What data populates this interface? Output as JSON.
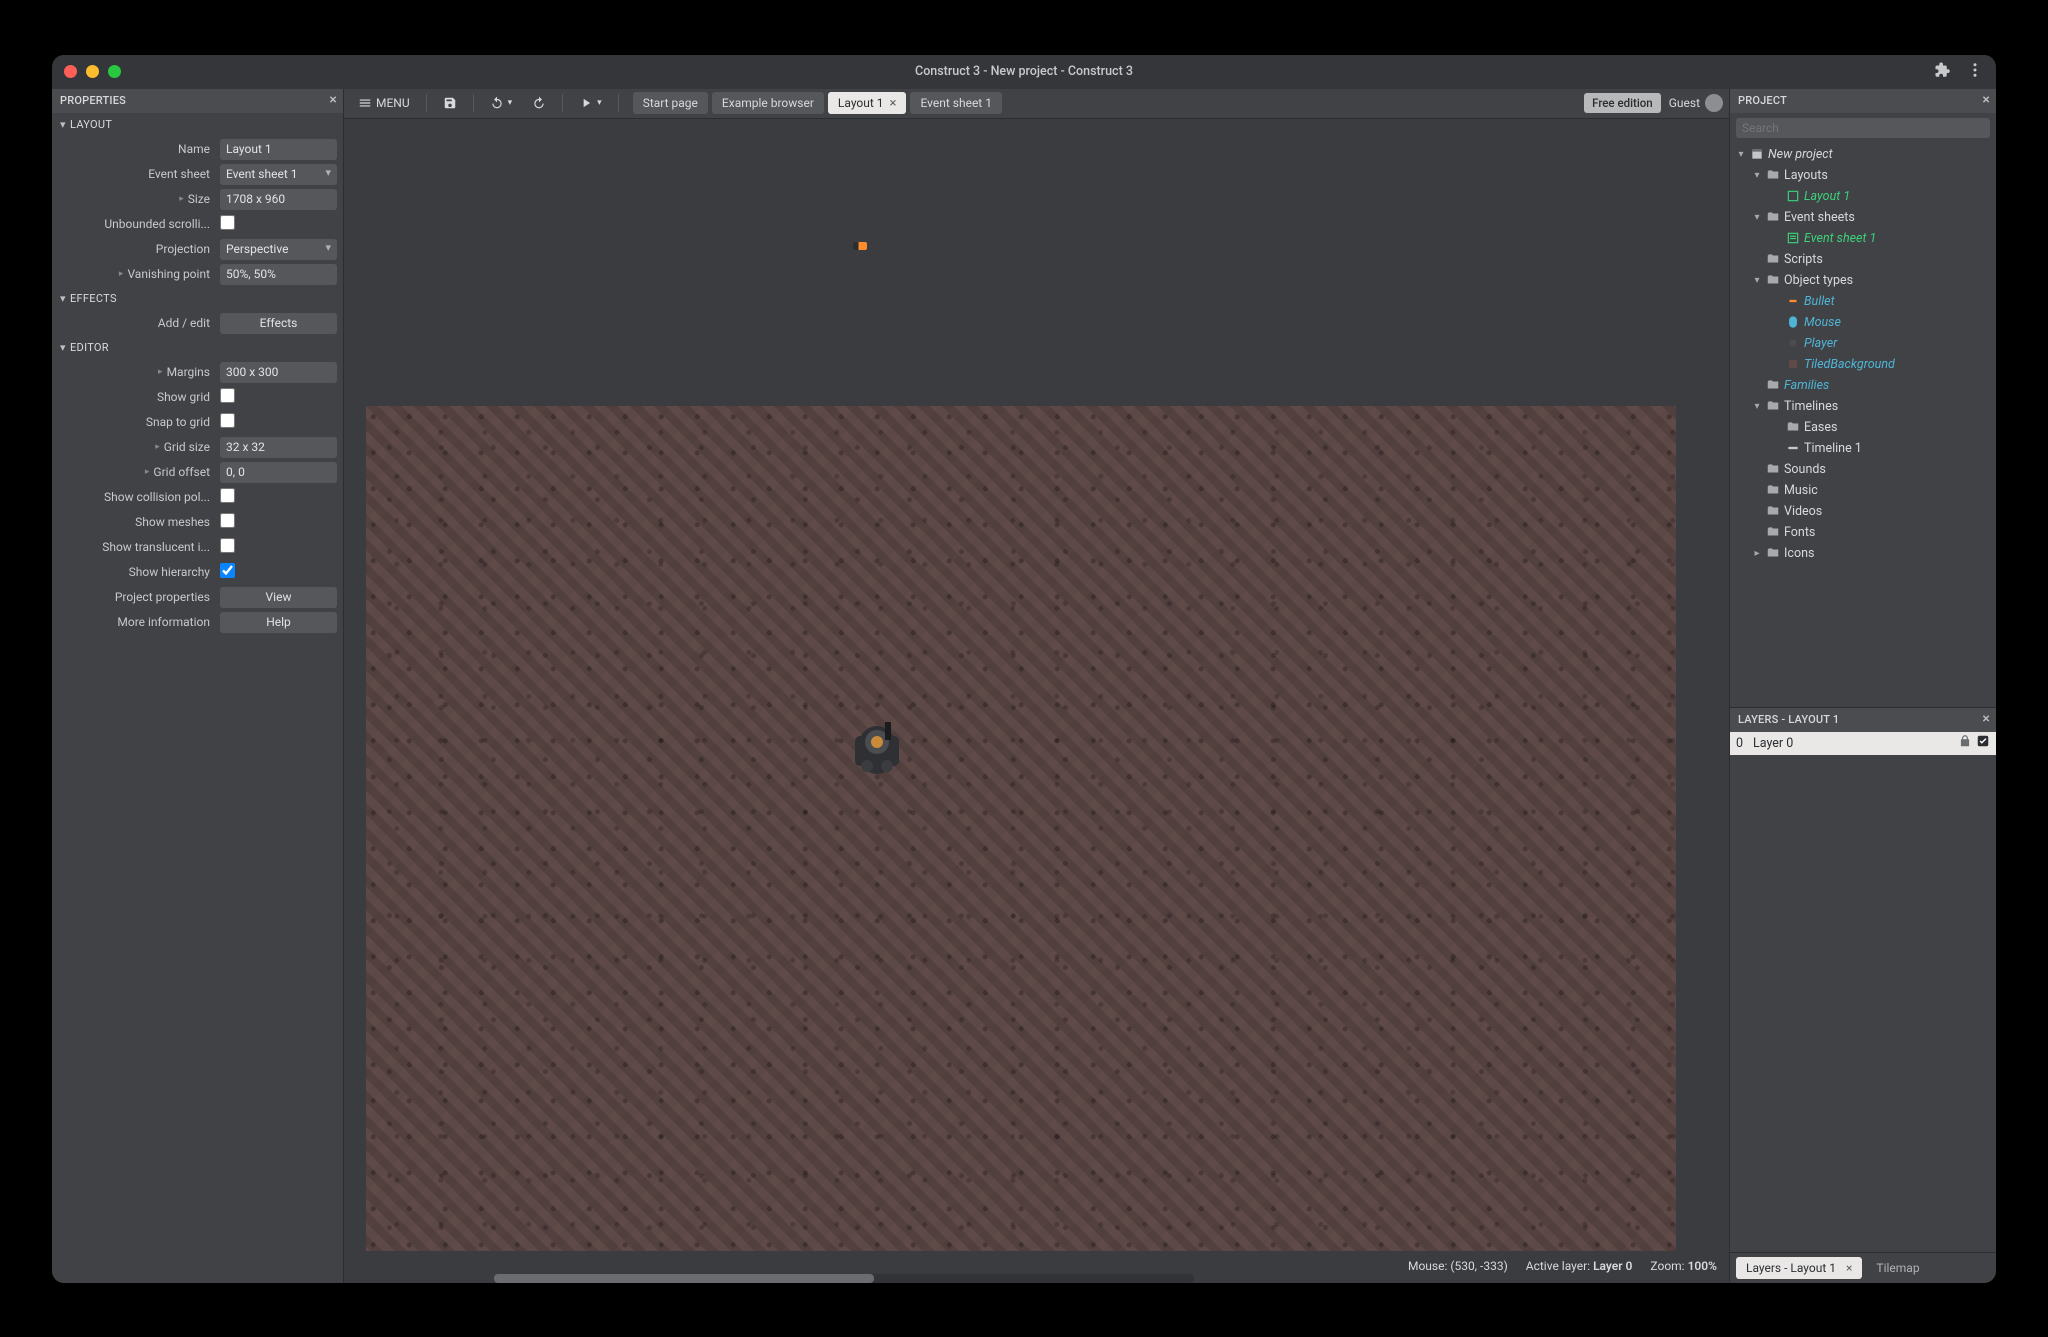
{
  "titlebar": {
    "title": "Construct 3 - New project - Construct 3"
  },
  "panels": {
    "properties_title": "PROPERTIES",
    "project_title": "PROJECT",
    "layers_title": "LAYERS - LAYOUT 1",
    "search_placeholder": "Search"
  },
  "toolbar": {
    "menu": "MENU",
    "free_edition": "Free edition",
    "guest": "Guest",
    "tabs": [
      {
        "label": "Start page"
      },
      {
        "label": "Example browser"
      },
      {
        "label": "Layout 1",
        "active": true,
        "closable": true
      },
      {
        "label": "Event sheet 1"
      }
    ]
  },
  "groups": {
    "layout": "LAYOUT",
    "effects": "EFFECTS",
    "editor": "EDITOR"
  },
  "properties": {
    "layout": {
      "name_label": "Name",
      "name_value": "Layout 1",
      "eventsheet_label": "Event sheet",
      "eventsheet_value": "Event sheet 1",
      "size_label": "Size",
      "size_value": "1708 x 960",
      "unbounded_label": "Unbounded scrolli...",
      "unbounded_value": false,
      "projection_label": "Projection",
      "projection_value": "Perspective",
      "vanishing_label": "Vanishing point",
      "vanishing_value": "50%, 50%"
    },
    "effects": {
      "addedit_label": "Add / edit",
      "addedit_button": "Effects"
    },
    "editor": {
      "margins_label": "Margins",
      "margins_value": "300 x 300",
      "showgrid_label": "Show grid",
      "showgrid_value": false,
      "snapgrid_label": "Snap to grid",
      "snapgrid_value": false,
      "gridsize_label": "Grid size",
      "gridsize_value": "32 x 32",
      "gridoffset_label": "Grid offset",
      "gridoffset_value": "0, 0",
      "showcollision_label": "Show collision pol...",
      "showcollision_value": false,
      "showmeshes_label": "Show meshes",
      "showmeshes_value": false,
      "showtranslucent_label": "Show translucent i...",
      "showtranslucent_value": false,
      "showhierarchy_label": "Show hierarchy",
      "showhierarchy_value": true,
      "projectprops_label": "Project properties",
      "projectprops_button": "View",
      "moreinfo_label": "More information",
      "moreinfo_button": "Help"
    }
  },
  "project_tree": {
    "root": "New project",
    "layouts": "Layouts",
    "layout1": "Layout 1",
    "eventsheets": "Event sheets",
    "eventsheet1": "Event sheet 1",
    "scripts": "Scripts",
    "objecttypes": "Object types",
    "obj_bullet": "Bullet",
    "obj_mouse": "Mouse",
    "obj_player": "Player",
    "obj_tiledbg": "TiledBackground",
    "families": "Families",
    "timelines": "Timelines",
    "eases": "Eases",
    "timeline1": "Timeline 1",
    "sounds": "Sounds",
    "music": "Music",
    "videos": "Videos",
    "fonts": "Fonts",
    "icons": "Icons"
  },
  "layers": {
    "items": [
      {
        "index": "0",
        "name": "Layer 0"
      }
    ]
  },
  "statusbar": {
    "mouse_label": "Mouse: ",
    "mouse_value": "(530, -333)",
    "activelayer_label": "Active layer: ",
    "activelayer_value": "Layer 0",
    "zoom_label": "Zoom: ",
    "zoom_value": "100%"
  },
  "bottom_tabs": {
    "layers": "Layers - Layout 1",
    "tilemap": "Tilemap"
  }
}
